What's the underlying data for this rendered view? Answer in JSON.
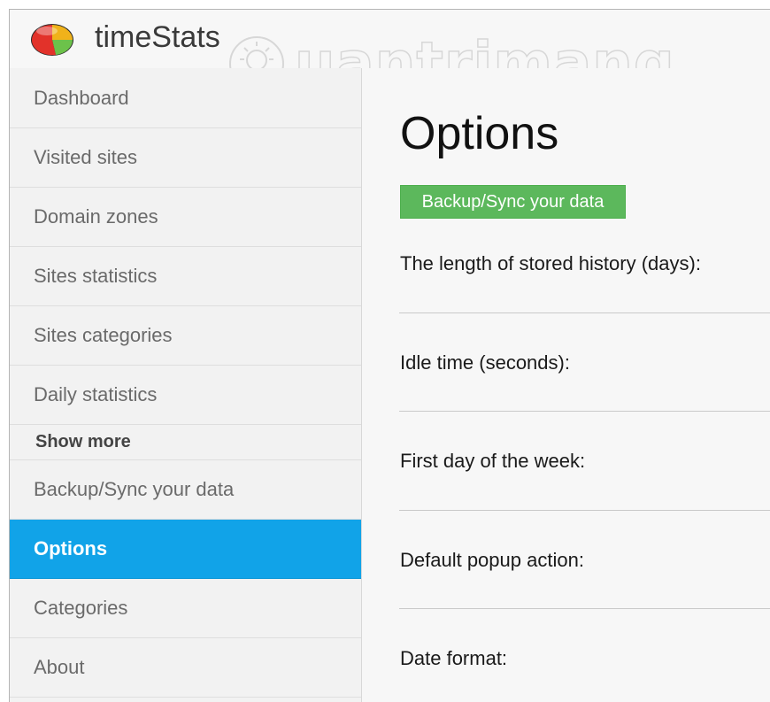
{
  "app": {
    "title": "timeStats",
    "logo_icon": "pie-chart-logo-icon",
    "watermark_text": "uantrimang",
    "watermark_icon": "lightbulb-icon"
  },
  "sidebar": {
    "items": [
      {
        "label": "Dashboard"
      },
      {
        "label": "Visited sites"
      },
      {
        "label": "Domain zones"
      },
      {
        "label": "Sites statistics"
      },
      {
        "label": "Sites categories"
      },
      {
        "label": "Daily statistics"
      },
      {
        "label": "Show more"
      },
      {
        "label": "Backup/Sync your data"
      },
      {
        "label": "Options"
      },
      {
        "label": "Categories"
      },
      {
        "label": "About"
      }
    ],
    "active_color": "#11a3e8"
  },
  "main": {
    "title": "Options",
    "sync_button_label": "Backup/Sync your data",
    "sync_button_color": "#5cb85c",
    "options": [
      {
        "label": "The length of stored history (days):"
      },
      {
        "label": "Idle time (seconds):"
      },
      {
        "label": "First day of the week:"
      },
      {
        "label": "Default popup action:"
      },
      {
        "label": "Date format:"
      }
    ]
  }
}
